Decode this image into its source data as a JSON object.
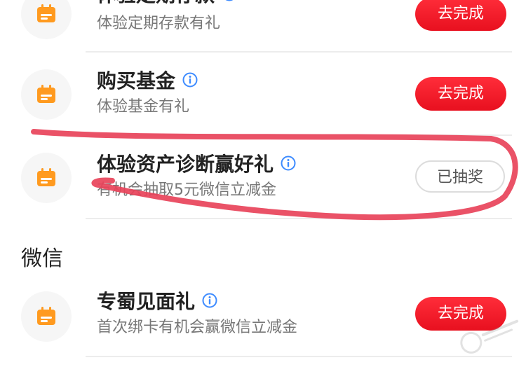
{
  "tasks": [
    {
      "title": "体验定期存款",
      "subtitle": "体验定期存款有礼",
      "action": "去完成",
      "status": "todo"
    },
    {
      "title": "购买基金",
      "subtitle": "体验基金有礼",
      "action": "去完成",
      "status": "todo"
    },
    {
      "title": "体验资产诊断赢好礼",
      "subtitle": "有机会抽取5元微信立减金",
      "action": "已抽奖",
      "status": "done"
    }
  ],
  "section": {
    "title": "微信"
  },
  "wechat_task": {
    "title": "专蜀见面礼",
    "subtitle": "首次绑卡有机会赢微信立减金",
    "action": "去完成"
  },
  "colors": {
    "accent_red": "#f0141f",
    "icon_orange": "#ff9a1f",
    "info_blue": "#3d8bff",
    "annotation_red": "#e8435a"
  },
  "icons": {
    "task_icon": "calendar-icon",
    "info_icon": "info-icon"
  }
}
